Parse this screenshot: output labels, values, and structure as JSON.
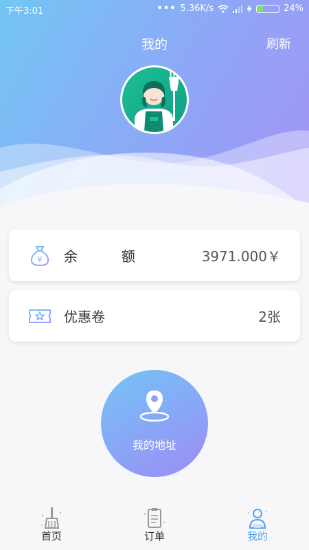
{
  "status_bar": {
    "time": "下午3:01",
    "network_speed": "5.36K/s",
    "battery": "24%",
    "battery_level": 0.24
  },
  "header": {
    "title": "我的",
    "refresh_label": "刷新"
  },
  "cards": {
    "balance": {
      "label": "余　额",
      "value": "3971.000￥",
      "icon": "money-bag-icon"
    },
    "coupon": {
      "label": "优惠卷",
      "value": "2张",
      "icon": "ticket-icon"
    }
  },
  "address_button": {
    "label": "我的地址",
    "icon": "location-pin-icon"
  },
  "tabbar": {
    "items": [
      {
        "label": "首页",
        "icon": "broom-icon",
        "active": false
      },
      {
        "label": "订单",
        "icon": "clipboard-icon",
        "active": false
      },
      {
        "label": "我的",
        "icon": "person-icon",
        "active": true
      }
    ]
  },
  "colors": {
    "gradient_start": "#72c6f4",
    "gradient_end": "#a592f7",
    "active_tab": "#4fa3f0",
    "avatar_bg": "#1fbf94"
  }
}
